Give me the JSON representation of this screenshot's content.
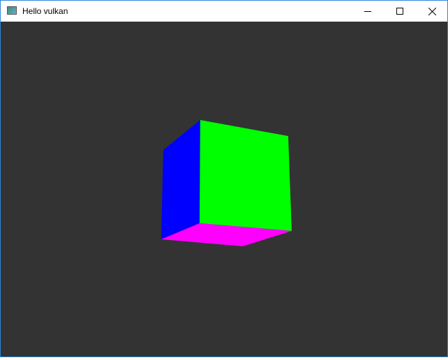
{
  "window": {
    "title": "Hello vulkan"
  },
  "icons": {
    "app": "app-window-icon",
    "minimize": "minimize-icon",
    "maximize": "maximize-icon",
    "close": "close-icon"
  },
  "scene": {
    "background": "#333333",
    "faces": {
      "left": "#0000ff",
      "front": "#00ff00",
      "bottom": "#ff00ff"
    }
  }
}
